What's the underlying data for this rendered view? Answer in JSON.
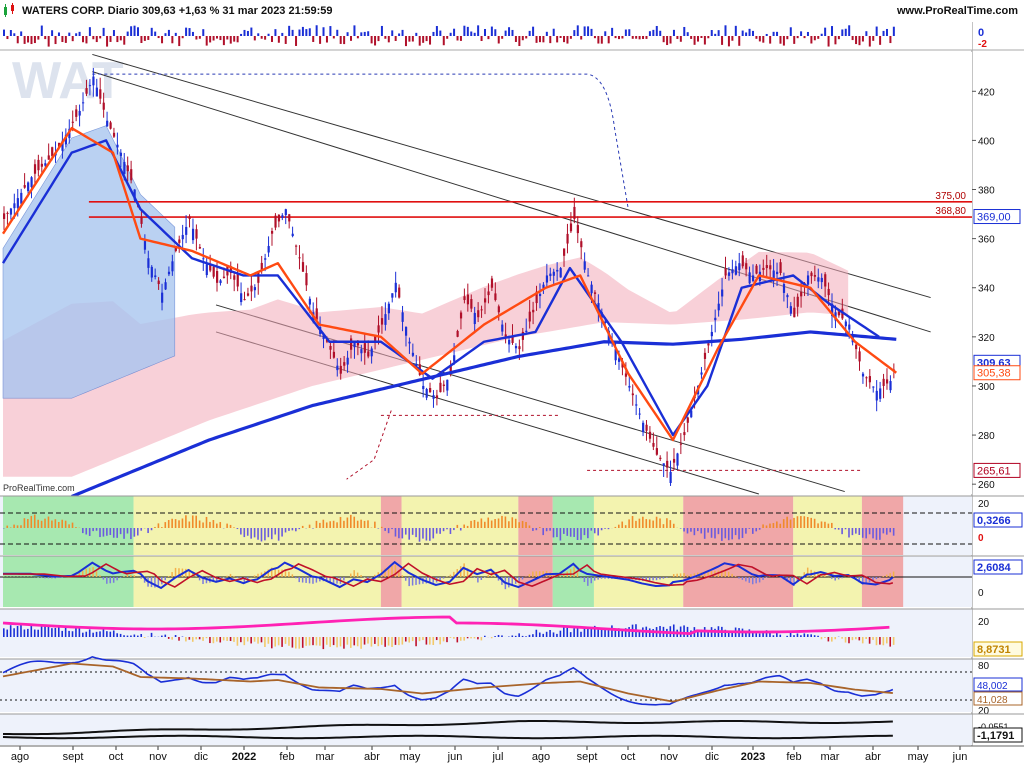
{
  "header": {
    "title": "WATERS CORP. Diario 309,63 +1,63 % 31 mar 2023 21:59:59",
    "site": "www.ProRealTime.com",
    "watermark": "WAT",
    "panel_brand": "ProRealTime.com"
  },
  "colors": {
    "bull": "#1a2fd6",
    "bear": "#b0102a",
    "ma_fast": "#1a2fd6",
    "ma_orange": "#ff4a12",
    "ma_slow": "#1a2fd6",
    "level_red": "#e01010",
    "band_blue": "#a9c6f0",
    "band_pink": "#f2a9b8",
    "zone_green": "#9fe7a7",
    "zone_yellow": "#f3f3a6",
    "zone_red": "#ef9e9e",
    "pink_line": "#ff22b4"
  },
  "chart_data": {
    "type": "candlestick",
    "xlabel": "",
    "ylabel": "",
    "x_ticks": [
      "ago",
      "sept",
      "oct",
      "nov",
      "dic",
      "2022",
      "feb",
      "mar",
      "abr",
      "may",
      "jun",
      "jul",
      "ago",
      "sept",
      "oct",
      "nov",
      "dic",
      "2023",
      "feb",
      "mar",
      "abr",
      "may",
      "jun"
    ],
    "y_ticks": [
      260,
      280,
      300,
      320,
      340,
      360,
      380,
      400,
      420
    ],
    "ylim": [
      256,
      436
    ],
    "horizontal_levels": [
      375.0,
      368.8
    ],
    "level_labels": [
      "375,00",
      "368,80"
    ],
    "price_tags": [
      {
        "label": "369,00",
        "value": 369.0,
        "kind": "ma"
      },
      {
        "label": "309,63",
        "value": 309.63,
        "kind": "last"
      },
      {
        "label": "305,38",
        "value": 305.38,
        "kind": "ma_orange"
      },
      {
        "label": "265,61",
        "value": 265.61,
        "kind": "support"
      }
    ],
    "close_path": [
      {
        "t": 0,
        "v": 368
      },
      {
        "t": 8,
        "v": 385
      },
      {
        "t": 15,
        "v": 395
      },
      {
        "t": 22,
        "v": 412
      },
      {
        "t": 26,
        "v": 426
      },
      {
        "t": 30,
        "v": 408
      },
      {
        "t": 34,
        "v": 395
      },
      {
        "t": 38,
        "v": 380
      },
      {
        "t": 42,
        "v": 352
      },
      {
        "t": 46,
        "v": 338
      },
      {
        "t": 50,
        "v": 355
      },
      {
        "t": 54,
        "v": 368
      },
      {
        "t": 58,
        "v": 352
      },
      {
        "t": 62,
        "v": 342
      },
      {
        "t": 66,
        "v": 346
      },
      {
        "t": 70,
        "v": 335
      },
      {
        "t": 74,
        "v": 342
      },
      {
        "t": 78,
        "v": 362
      },
      {
        "t": 82,
        "v": 372
      },
      {
        "t": 86,
        "v": 352
      },
      {
        "t": 90,
        "v": 330
      },
      {
        "t": 94,
        "v": 318
      },
      {
        "t": 98,
        "v": 305
      },
      {
        "t": 102,
        "v": 318
      },
      {
        "t": 106,
        "v": 312
      },
      {
        "t": 110,
        "v": 325
      },
      {
        "t": 114,
        "v": 342
      },
      {
        "t": 118,
        "v": 318
      },
      {
        "t": 122,
        "v": 300
      },
      {
        "t": 126,
        "v": 295
      },
      {
        "t": 130,
        "v": 305
      },
      {
        "t": 134,
        "v": 335
      },
      {
        "t": 138,
        "v": 328
      },
      {
        "t": 142,
        "v": 340
      },
      {
        "t": 146,
        "v": 320
      },
      {
        "t": 150,
        "v": 315
      },
      {
        "t": 154,
        "v": 330
      },
      {
        "t": 158,
        "v": 345
      },
      {
        "t": 162,
        "v": 348
      },
      {
        "t": 166,
        "v": 368
      },
      {
        "t": 170,
        "v": 345
      },
      {
        "t": 174,
        "v": 330
      },
      {
        "t": 178,
        "v": 315
      },
      {
        "t": 182,
        "v": 300
      },
      {
        "t": 186,
        "v": 285
      },
      {
        "t": 190,
        "v": 272
      },
      {
        "t": 194,
        "v": 265
      },
      {
        "t": 198,
        "v": 280
      },
      {
        "t": 202,
        "v": 300
      },
      {
        "t": 206,
        "v": 322
      },
      {
        "t": 210,
        "v": 345
      },
      {
        "t": 214,
        "v": 350
      },
      {
        "t": 218,
        "v": 345
      },
      {
        "t": 222,
        "v": 348
      },
      {
        "t": 226,
        "v": 346
      },
      {
        "t": 230,
        "v": 328
      },
      {
        "t": 234,
        "v": 345
      },
      {
        "t": 238,
        "v": 344
      },
      {
        "t": 242,
        "v": 330
      },
      {
        "t": 246,
        "v": 325
      },
      {
        "t": 250,
        "v": 305
      },
      {
        "t": 254,
        "v": 298
      },
      {
        "t": 258,
        "v": 302
      },
      {
        "t": 260,
        "v": 309.63
      }
    ],
    "sma_blue_fast_path": [
      {
        "t": 0,
        "v": 350
      },
      {
        "t": 20,
        "v": 395
      },
      {
        "t": 30,
        "v": 400
      },
      {
        "t": 40,
        "v": 372
      },
      {
        "t": 55,
        "v": 352
      },
      {
        "t": 70,
        "v": 345
      },
      {
        "t": 80,
        "v": 345
      },
      {
        "t": 95,
        "v": 318
      },
      {
        "t": 110,
        "v": 318
      },
      {
        "t": 125,
        "v": 303
      },
      {
        "t": 140,
        "v": 318
      },
      {
        "t": 155,
        "v": 322
      },
      {
        "t": 165,
        "v": 348
      },
      {
        "t": 180,
        "v": 318
      },
      {
        "t": 195,
        "v": 280
      },
      {
        "t": 205,
        "v": 300
      },
      {
        "t": 215,
        "v": 340
      },
      {
        "t": 230,
        "v": 345
      },
      {
        "t": 240,
        "v": 334
      },
      {
        "t": 255,
        "v": 320
      }
    ],
    "ema_orange_path": [
      {
        "t": 0,
        "v": 362
      },
      {
        "t": 20,
        "v": 405
      },
      {
        "t": 32,
        "v": 395
      },
      {
        "t": 40,
        "v": 360
      },
      {
        "t": 55,
        "v": 355
      },
      {
        "t": 72,
        "v": 345
      },
      {
        "t": 80,
        "v": 350
      },
      {
        "t": 92,
        "v": 325
      },
      {
        "t": 110,
        "v": 320
      },
      {
        "t": 122,
        "v": 305
      },
      {
        "t": 140,
        "v": 325
      },
      {
        "t": 158,
        "v": 340
      },
      {
        "t": 168,
        "v": 345
      },
      {
        "t": 182,
        "v": 305
      },
      {
        "t": 195,
        "v": 278
      },
      {
        "t": 208,
        "v": 315
      },
      {
        "t": 220,
        "v": 345
      },
      {
        "t": 235,
        "v": 340
      },
      {
        "t": 248,
        "v": 318
      },
      {
        "t": 260,
        "v": 305.38
      }
    ],
    "sma_slow_path": [
      {
        "t": 20,
        "v": 255
      },
      {
        "t": 60,
        "v": 278
      },
      {
        "t": 90,
        "v": 292
      },
      {
        "t": 120,
        "v": 302
      },
      {
        "t": 150,
        "v": 312
      },
      {
        "t": 175,
        "v": 318
      },
      {
        "t": 195,
        "v": 317
      },
      {
        "t": 215,
        "v": 319
      },
      {
        "t": 235,
        "v": 322
      },
      {
        "t": 260,
        "v": 319
      }
    ],
    "rsi_panel_labels": [
      "20",
      "0,3266",
      "0"
    ],
    "macd_panel_labels": [
      "2,6084",
      "0"
    ],
    "momentum_panel_labels": [
      "20",
      "8,8731"
    ],
    "stoch_panel_labels": [
      "80",
      "48,002",
      "41,028",
      "20"
    ],
    "volume_panel_labels": [
      "-0,0551",
      "-1,1791"
    ],
    "top_strip_labels": [
      "0",
      "-2"
    ]
  }
}
